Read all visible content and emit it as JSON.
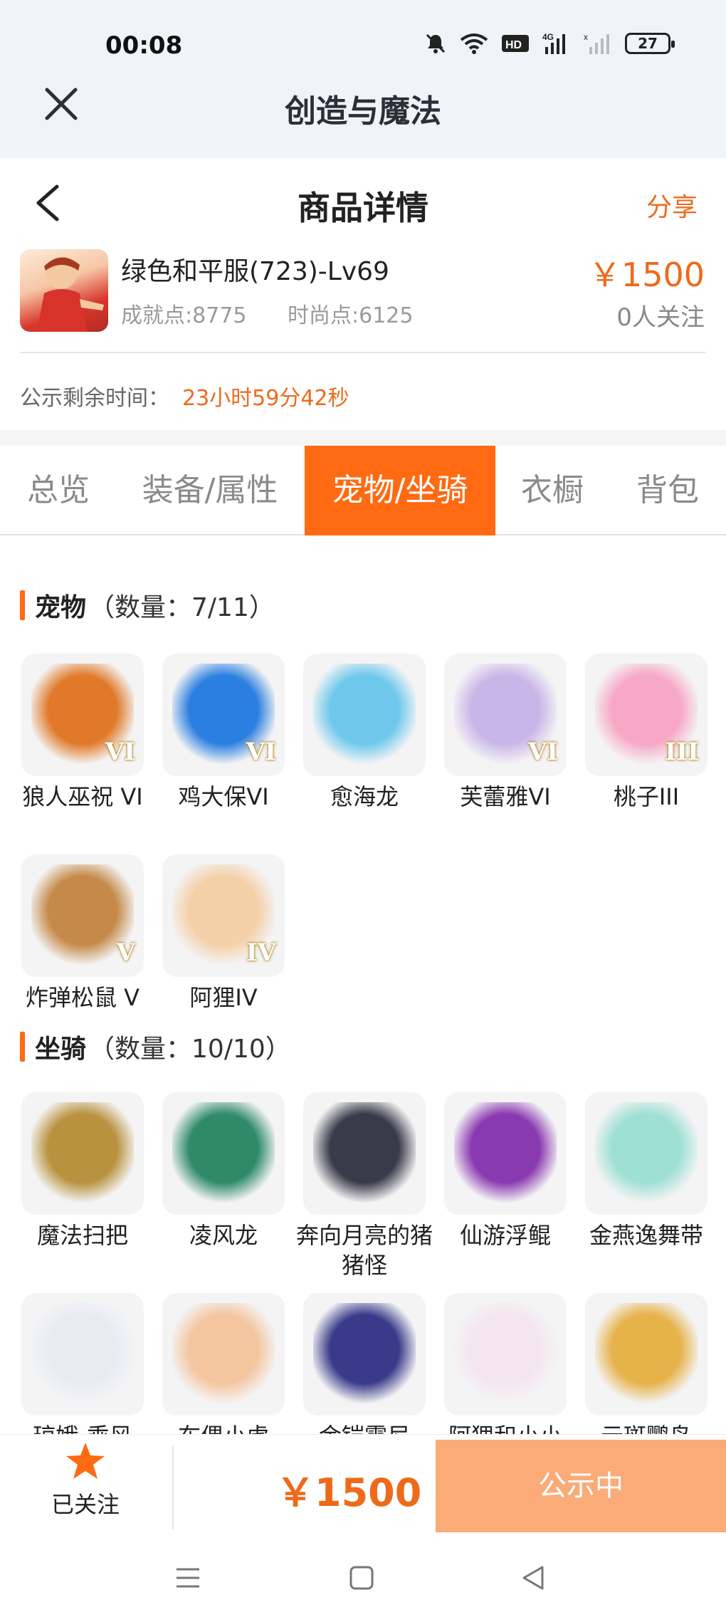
{
  "status_bar": {
    "time": "00:08",
    "battery": "27"
  },
  "app_bar": {
    "title": "创造与魔法"
  },
  "header": {
    "title": "商品详情",
    "share": "分享"
  },
  "product": {
    "name": "绿色和平服(723)-Lv69",
    "achievement": "成就点:8775",
    "fashion": "时尚点:6125",
    "price": "￥1500",
    "followers": "0人关注",
    "countdown_label": "公示剩余时间：",
    "countdown_value": "23小时59分42秒"
  },
  "tabs": [
    "总览",
    "装备/属性",
    "宠物/坐骑",
    "衣橱",
    "背包"
  ],
  "active_tab": "宠物/坐骑",
  "pets": {
    "title": "宠物",
    "count": "（数量：7/11）",
    "items": [
      {
        "name": "狼人巫祝 VI",
        "rank": "VI",
        "color": "#e07a2a"
      },
      {
        "name": "鸡大保VI",
        "rank": "VI",
        "color": "#2b7fe0"
      },
      {
        "name": "愈海龙",
        "rank": "",
        "color": "#6fc8ec"
      },
      {
        "name": "芙蕾雅VI",
        "rank": "VI",
        "color": "#c9b6e8"
      },
      {
        "name": "桃子III",
        "rank": "III",
        "color": "#f7a8c4"
      },
      {
        "name": "炸弹松鼠 V",
        "rank": "V",
        "color": "#c58a4a"
      },
      {
        "name": "阿狸IV",
        "rank": "IV",
        "color": "#f4d0a8"
      }
    ]
  },
  "mounts": {
    "title": "坐骑",
    "count": "（数量：10/10）",
    "items": [
      {
        "name": "魔法扫把",
        "color": "#b8923e"
      },
      {
        "name": "凌风龙",
        "color": "#2f8a6a"
      },
      {
        "name": "奔向月亮的猪猪怪",
        "color": "#3a3a4a"
      },
      {
        "name": "仙游浮鲲",
        "color": "#8a3ab0"
      },
      {
        "name": "金燕逸舞带",
        "color": "#9fe0d4"
      },
      {
        "name": "琼娥-乘风",
        "color": "#e8ecf2"
      },
      {
        "name": "布偶小虎",
        "color": "#f3c6a0"
      },
      {
        "name": "金铠霆尼",
        "color": "#3a3a8a"
      },
      {
        "name": "阿狸和小小",
        "color": "#f4e6ee"
      },
      {
        "name": "云斑鹦鸟",
        "color": "#e6b24a"
      }
    ]
  },
  "bottom_bar": {
    "follow_label": "已关注",
    "price": "￥1500",
    "status_button": "公示中"
  }
}
